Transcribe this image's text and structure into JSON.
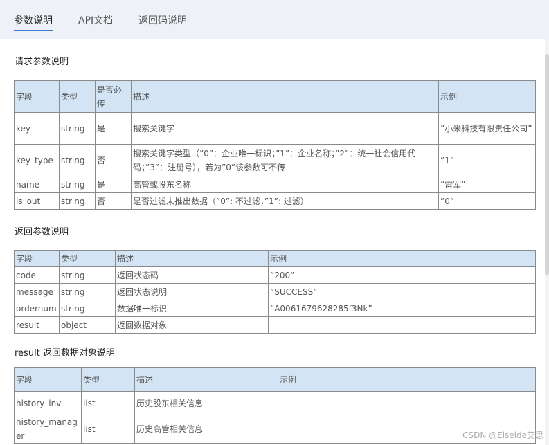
{
  "tabs": [
    {
      "label": "参数说明",
      "active": true
    },
    {
      "label": "API文档",
      "active": false
    },
    {
      "label": "返回码说明",
      "active": false
    }
  ],
  "request_section": {
    "title": "请求参数说明",
    "headers": [
      "字段",
      "类型",
      "是否必传",
      "描述",
      "示例"
    ],
    "rows": [
      [
        "key",
        "string",
        "是",
        "搜索关键字",
        "”小米科技有限责任公司”"
      ],
      [
        "key_type",
        "string",
        "否",
        "搜索关键字类型（”0”：企业唯一标识；”1”：企业名称；”2”：统一社会信用代码；”3”：注册号），若为”0”该参数可不传",
        "”1”"
      ],
      [
        "name",
        "string",
        "是",
        "高管或股东名称",
        "”雷军”"
      ],
      [
        "is_out",
        "string",
        "否",
        "是否过滤未推出数据（”0”: 不过滤，”1”: 过滤）",
        "”0”"
      ]
    ]
  },
  "return_section": {
    "title": "返回参数说明",
    "headers": [
      "字段",
      "类型",
      "描述",
      "示例"
    ],
    "rows": [
      [
        "code",
        "string",
        "返回状态码",
        "”200”"
      ],
      [
        "message",
        "string",
        "返回状态说明",
        "”SUCCESS”"
      ],
      [
        "ordernum",
        "string",
        "数据唯一标识",
        "”A0061679628285f3Nk”"
      ],
      [
        "result",
        "object",
        "返回数据对象",
        ""
      ]
    ]
  },
  "result_section": {
    "title": "result 返回数据对象说明",
    "headers": [
      "字段",
      "类型",
      "描述",
      "示例"
    ],
    "rows": [
      [
        "history_inv",
        "list",
        "历史股东相关信息",
        ""
      ],
      [
        "history_manager",
        "list",
        "历史高管相关信息",
        ""
      ]
    ]
  },
  "watermark": "CSDN @Elseide艾思",
  "colors": {
    "topbar_bg": "#eef1f7",
    "header_bg": "#d3e5f5",
    "active_tab_underline": "#3a7bd5"
  }
}
